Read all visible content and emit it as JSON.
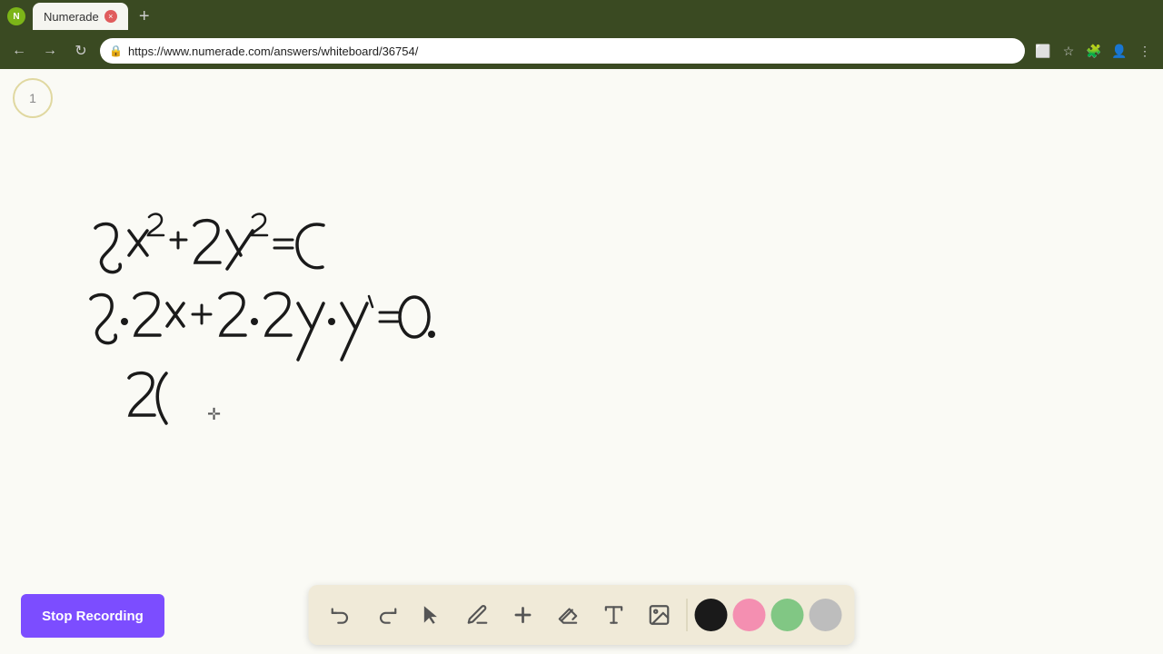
{
  "browser": {
    "tab_title": "Numerade",
    "tab_close_label": "×",
    "new_tab_label": "+",
    "url": "https://www.numerade.com/answers/whiteboard/36754/",
    "nav_back": "←",
    "nav_forward": "→",
    "nav_reload": "↻"
  },
  "page_indicator": {
    "number": "1"
  },
  "toolbar": {
    "undo_label": "↺",
    "redo_label": "↻",
    "select_label": "▲",
    "pen_label": "✏",
    "add_label": "+",
    "eraser_label": "◻",
    "text_label": "A",
    "image_label": "🖼",
    "colors": [
      "#1a1a1a",
      "#f48fb1",
      "#81c784",
      "#bdbdbd"
    ]
  },
  "stop_recording": {
    "label": "Stop Recording"
  }
}
